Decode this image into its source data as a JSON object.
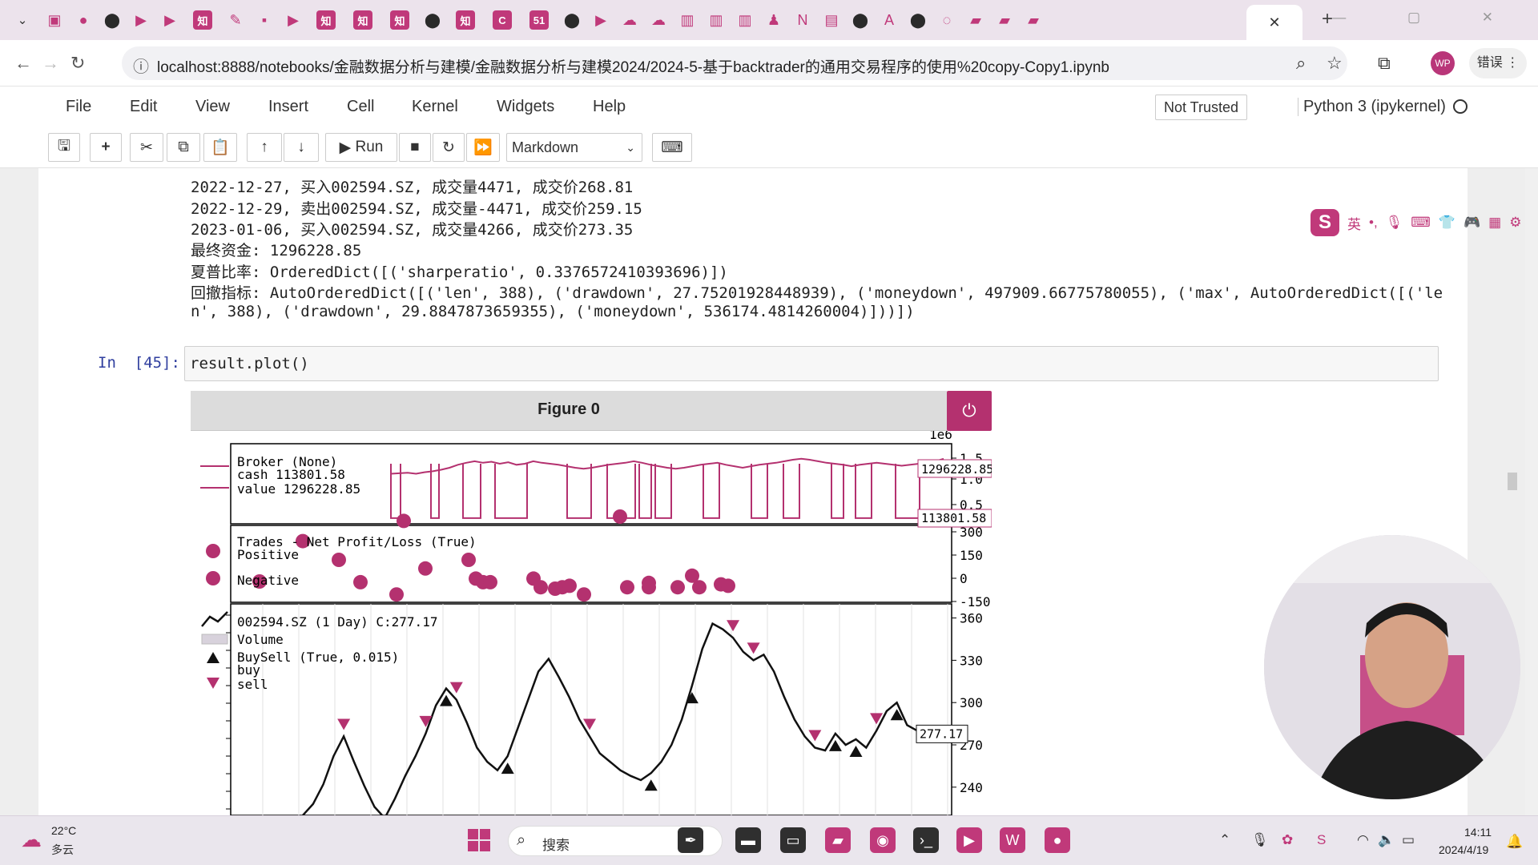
{
  "browser": {
    "tab_icons": [
      "bilibili-icon",
      "record-icon",
      "github-icon",
      "video-icon",
      "video-icon",
      "zhihu-icon",
      "bookmark-icon",
      "app-icon",
      "video-icon",
      "zhihu-icon",
      "zhihu-icon",
      "zhihu-icon",
      "github-icon",
      "zhihu-icon",
      "c-icon",
      "51-icon",
      "github-icon",
      "video-icon",
      "cloud-icon",
      "cloud-icon",
      "book-icon",
      "book-icon",
      "book-icon",
      "user-icon",
      "onenote-icon",
      "doc-icon",
      "github-icon",
      "ai-icon",
      "github-icon",
      "loading-icon",
      "folder-icon",
      "folder-icon",
      "folder-icon"
    ],
    "active_tab_close": "✕",
    "new_tab": "+",
    "url": "localhost:8888/notebooks/金融数据分析与建模/金融数据分析与建模2024/2024-5-基于backtrader的通用交易程序的使用%20copy-Copy1.ipynb",
    "profile_initials": "WP",
    "error_button": "错误"
  },
  "jupyter": {
    "menu": [
      "File",
      "Edit",
      "View",
      "Insert",
      "Cell",
      "Kernel",
      "Widgets",
      "Help"
    ],
    "trust_status": "Not Trusted",
    "kernel": "Python 3 (ipykernel)",
    "toolbar": {
      "run_label": "Run",
      "cell_type": "Markdown"
    }
  },
  "output_lines": [
    "2022-12-27, 买入002594.SZ, 成交量4471, 成交价268.81",
    "2022-12-29, 卖出002594.SZ, 成交量-4471, 成交价259.15",
    "2023-01-06, 买入002594.SZ, 成交量4266, 成交价273.35",
    "最终资金: 1296228.85",
    "夏普比率: OrderedDict([('sharperatio', 0.3376572410393696)])",
    "回撤指标: AutoOrderedDict([('len', 388), ('drawdown', 27.75201928448939), ('moneydown', 497909.66775780055), ('max', AutoOrderedDict([('le",
    "n', 388), ('drawdown', 29.8847873659355), ('moneydown', 536174.4814260004)]))])"
  ],
  "cell": {
    "prompt": "In  [45]:",
    "code": "result.plot()"
  },
  "figure": {
    "title": "Figure 0",
    "power_icon": "⏻"
  },
  "chart_data": {
    "type": "line",
    "panels": [
      {
        "name": "broker",
        "legend": [
          "Broker (None)",
          "cash 113801.58",
          "value 1296228.85"
        ],
        "scale_label": "1e6",
        "y_ticks": [
          "1.5",
          "1.0",
          "0.5"
        ],
        "value_tag": "1296228.85",
        "cash_tag": "113801.58",
        "value_series": [
          1.0,
          1.01,
          1.02,
          1.0,
          1.03,
          1.05,
          1.08,
          1.12,
          1.18,
          1.22,
          1.25,
          1.22,
          1.24,
          1.2,
          1.23,
          1.18,
          1.2,
          1.25,
          1.22,
          1.2,
          1.18,
          1.15,
          1.12,
          1.1,
          1.12,
          1.15,
          1.18,
          1.2,
          1.22,
          1.25,
          1.22,
          1.18,
          1.15,
          1.12,
          1.1,
          1.12,
          1.15,
          1.18,
          1.2,
          1.22,
          1.18,
          1.15,
          1.12,
          1.15,
          1.18,
          1.2,
          1.22,
          1.25,
          1.28,
          1.3,
          1.28,
          1.25,
          1.22,
          1.2,
          1.18,
          1.15,
          1.18,
          1.2,
          1.22,
          1.2,
          1.18,
          1.16,
          1.18,
          1.2,
          1.22,
          1.25,
          1.3
        ],
        "cash_low": 0.114
      },
      {
        "name": "trades",
        "legend": [
          "Trades - Net Profit/Loss (True)",
          "Positive",
          "Negative"
        ],
        "y_ticks": [
          "300",
          "150",
          "0",
          "-150"
        ],
        "points": [
          {
            "x": 0.04,
            "y": 0
          },
          {
            "x": 0.1,
            "y": 280
          },
          {
            "x": 0.15,
            "y": 150
          },
          {
            "x": 0.18,
            "y": -5
          },
          {
            "x": 0.23,
            "y": -90
          },
          {
            "x": 0.24,
            "y": 420
          },
          {
            "x": 0.27,
            "y": 90
          },
          {
            "x": 0.33,
            "y": 150
          },
          {
            "x": 0.34,
            "y": 20
          },
          {
            "x": 0.35,
            "y": -5
          },
          {
            "x": 0.36,
            "y": -5
          },
          {
            "x": 0.42,
            "y": 20
          },
          {
            "x": 0.43,
            "y": -40
          },
          {
            "x": 0.45,
            "y": -50
          },
          {
            "x": 0.46,
            "y": -40
          },
          {
            "x": 0.47,
            "y": -30
          },
          {
            "x": 0.49,
            "y": -90
          },
          {
            "x": 0.54,
            "y": 450
          },
          {
            "x": 0.55,
            "y": -40
          },
          {
            "x": 0.58,
            "y": -10
          },
          {
            "x": 0.58,
            "y": -40
          },
          {
            "x": 0.62,
            "y": -40
          },
          {
            "x": 0.64,
            "y": 40
          },
          {
            "x": 0.65,
            "y": -40
          },
          {
            "x": 0.68,
            "y": -20
          },
          {
            "x": 0.69,
            "y": -30
          }
        ]
      },
      {
        "name": "price",
        "legend": [
          "002594.SZ (1 Day) C:277.17",
          "Volume",
          "BuySell (True, 0.015)",
          "buy",
          "sell"
        ],
        "y_ticks": [
          "360",
          "330",
          "300",
          "270",
          "240"
        ],
        "last_tag": "277.17",
        "close": [
          220,
          228,
          242,
          262,
          276,
          258,
          241,
          226,
          218,
          232,
          248,
          262,
          278,
          298,
          310,
          302,
          286,
          268,
          258,
          252,
          262,
          282,
          302,
          322,
          331,
          318,
          304,
          288,
          276,
          264,
          258,
          252,
          248,
          245,
          250,
          258,
          270,
          288,
          312,
          338,
          356,
          352,
          346,
          336,
          330,
          334,
          322,
          304,
          288,
          276,
          268,
          266,
          278,
          270,
          274,
          268,
          280,
          294,
          300,
          284,
          280,
          277
        ]
      }
    ],
    "colors": {
      "accent": "#b4316f",
      "price_line": "#111111",
      "marker": "#b4316f"
    }
  },
  "overlays": {
    "ime": [
      "英",
      "•,",
      "mic-icon",
      "keyboard-icon",
      "shirt-icon",
      "gamepad-icon",
      "grid-icon",
      "gear-icon"
    ],
    "ime_logo": "S"
  },
  "taskbar": {
    "weather_temp": "22°C",
    "weather_desc": "多云",
    "search_placeholder": "搜索",
    "apps": [
      {
        "icon": "feather-icon",
        "color": "#2f2f2f"
      },
      {
        "icon": "monitor-icon",
        "color": "#2f2f2f"
      },
      {
        "icon": "console-icon",
        "color": "#2f2f2f"
      },
      {
        "icon": "folder-icon",
        "color": "#c0397a"
      },
      {
        "icon": "chrome-icon",
        "color": "#c0397a"
      },
      {
        "icon": "terminal-icon",
        "color": "#2f2f2f"
      },
      {
        "icon": "pdf-icon",
        "color": "#c0397a"
      },
      {
        "icon": "wps-icon",
        "color": "#c0397a"
      },
      {
        "icon": "record-icon",
        "color": "#c0397a"
      }
    ],
    "clock_time": "14:11",
    "clock_date": "2024/4/19"
  }
}
